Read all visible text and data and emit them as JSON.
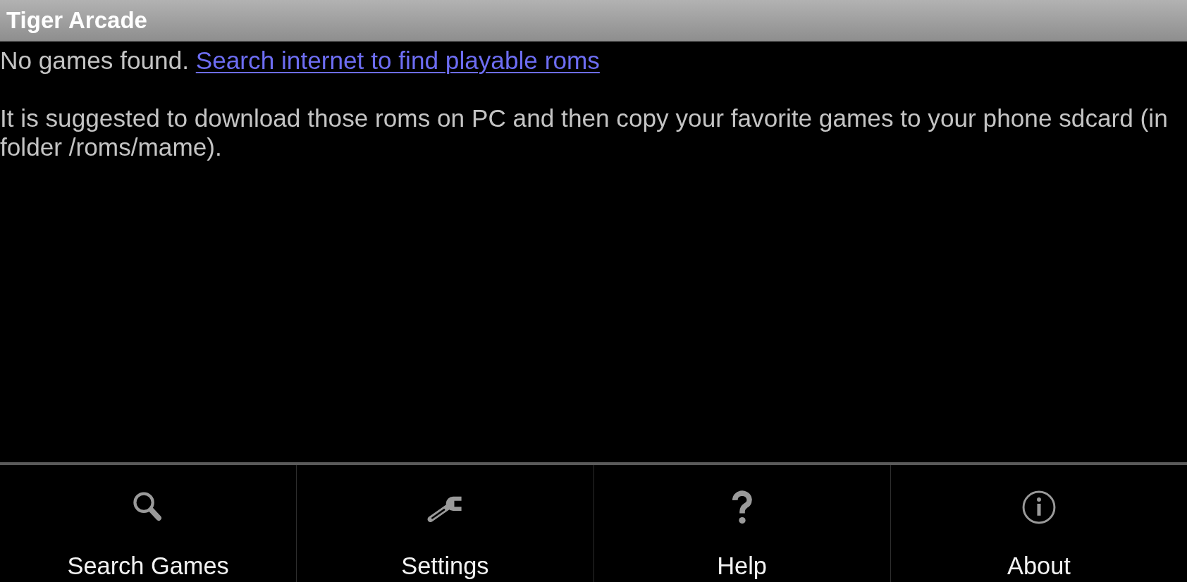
{
  "window": {
    "title": "Tiger Arcade"
  },
  "message": {
    "text": "No games found.",
    "link": "Search internet to find playable roms"
  },
  "hint": "It is suggested to download those roms on PC and then copy your favorite games to your phone sdcard (in folder /roms/mame).",
  "toolbar": [
    {
      "kind": "search",
      "label": "Search Games"
    },
    {
      "kind": "settings",
      "label": "Settings"
    },
    {
      "kind": "help",
      "label": "Help"
    },
    {
      "kind": "about",
      "label": "About"
    }
  ]
}
